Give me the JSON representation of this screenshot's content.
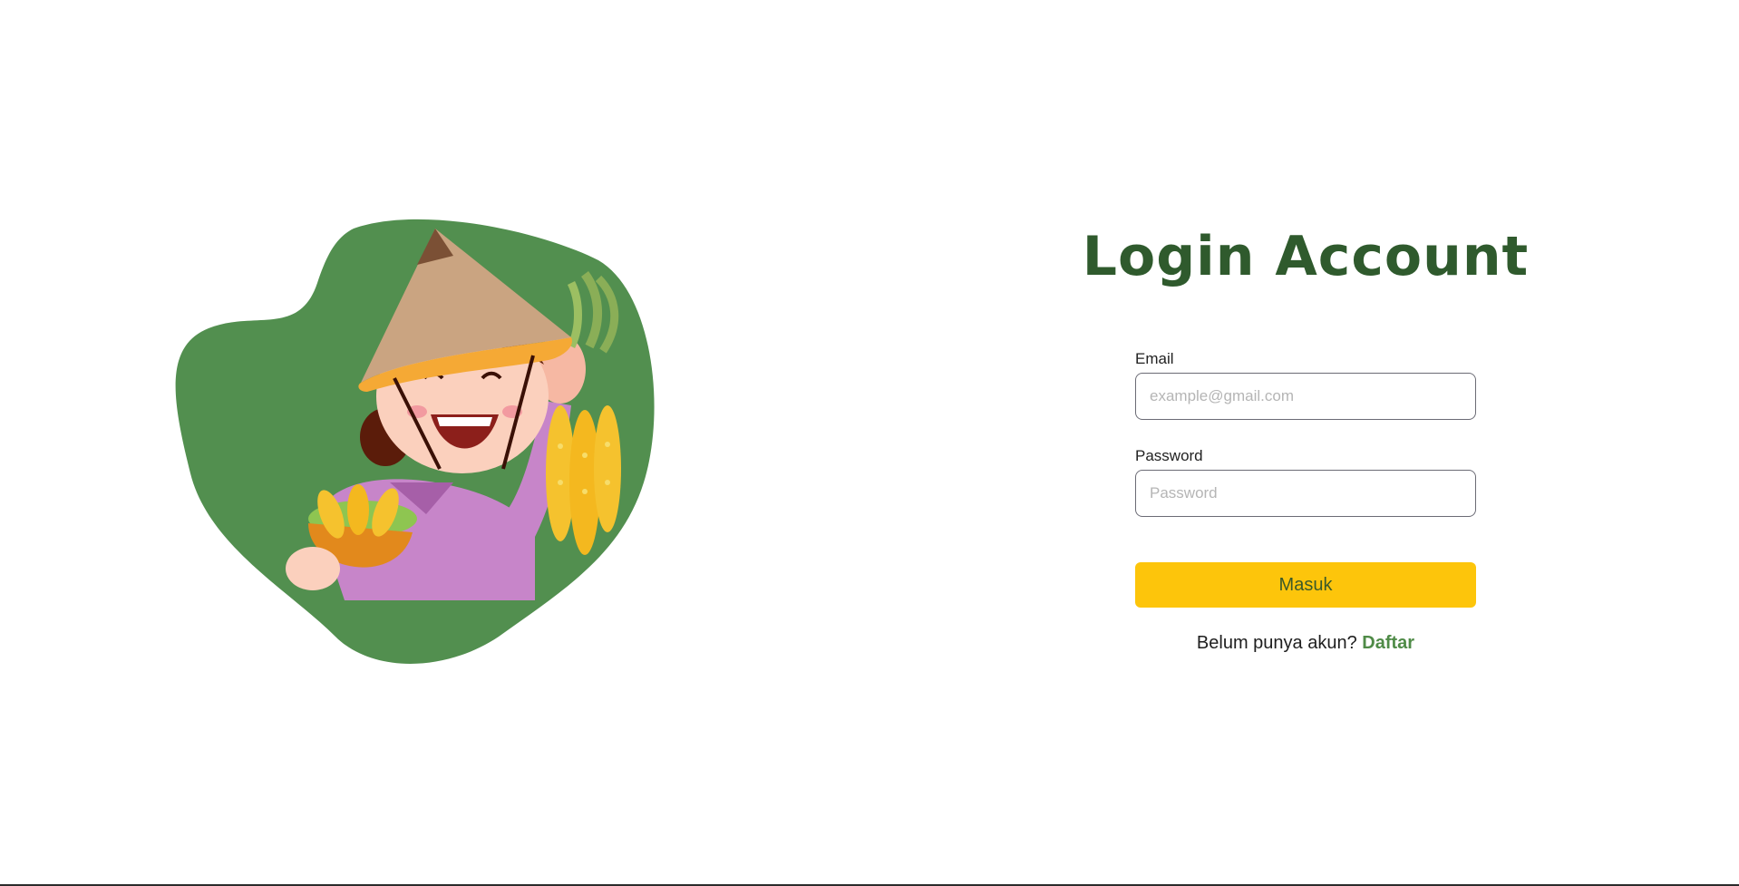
{
  "login": {
    "title": "Login Account",
    "email": {
      "label": "Email",
      "placeholder": "example@gmail.com",
      "value": ""
    },
    "password": {
      "label": "Password",
      "placeholder": "Password",
      "value": ""
    },
    "submit_label": "Masuk",
    "register_prompt": "Belum punya akun?",
    "register_link": "Daftar"
  },
  "illustration": {
    "subject": "farmer-woman-holding-corn-icon"
  },
  "colors": {
    "title": "#2f5a2d",
    "blob": "#528f4f",
    "button_bg": "#fdc50b",
    "button_text": "#3b5a2a",
    "link": "#4f8b47"
  }
}
